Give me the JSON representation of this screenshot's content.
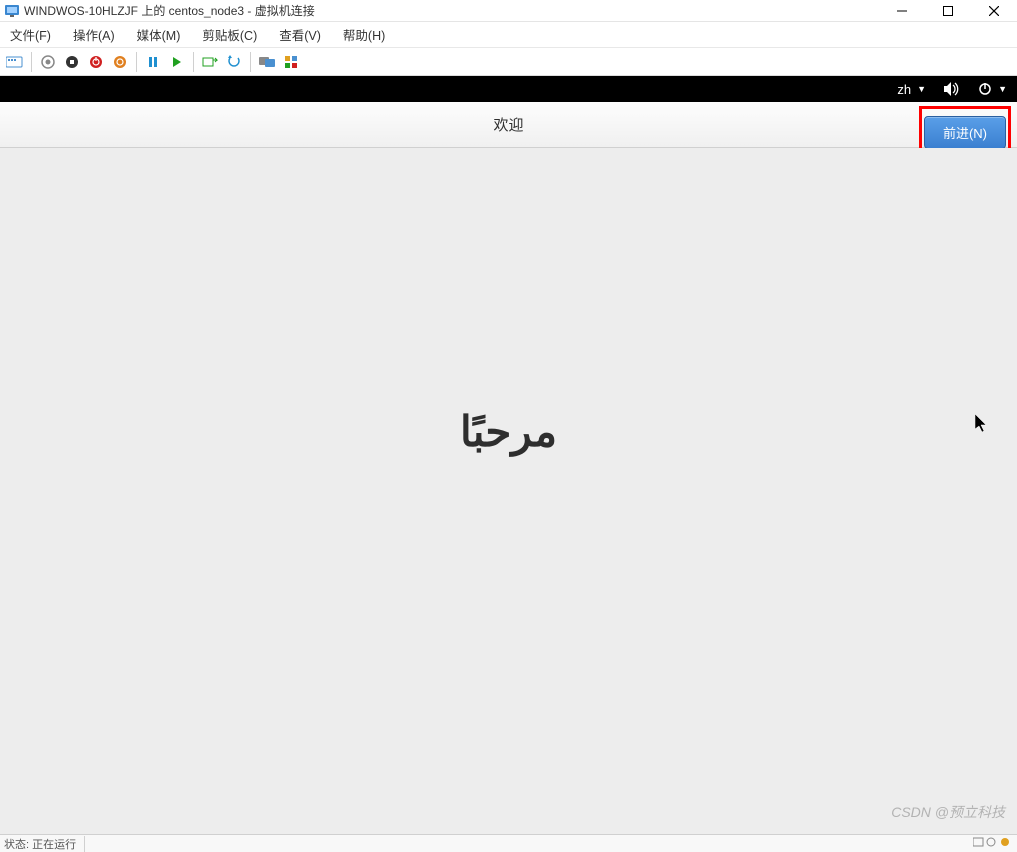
{
  "window": {
    "title": "WINDWOS-10HLZJF 上的 centos_node3 - 虚拟机连接"
  },
  "menubar": {
    "file": "文件(F)",
    "action": "操作(A)",
    "media": "媒体(M)",
    "clipboard": "剪贴板(C)",
    "view": "查看(V)",
    "help": "帮助(H)"
  },
  "gnome": {
    "lang": "zh"
  },
  "welcome": {
    "title": "欢迎",
    "next_label": "前进(N)",
    "greeting": "مرحبًا"
  },
  "watermark": "CSDN @预立科技",
  "status": {
    "left": "状态: 正在运行"
  }
}
